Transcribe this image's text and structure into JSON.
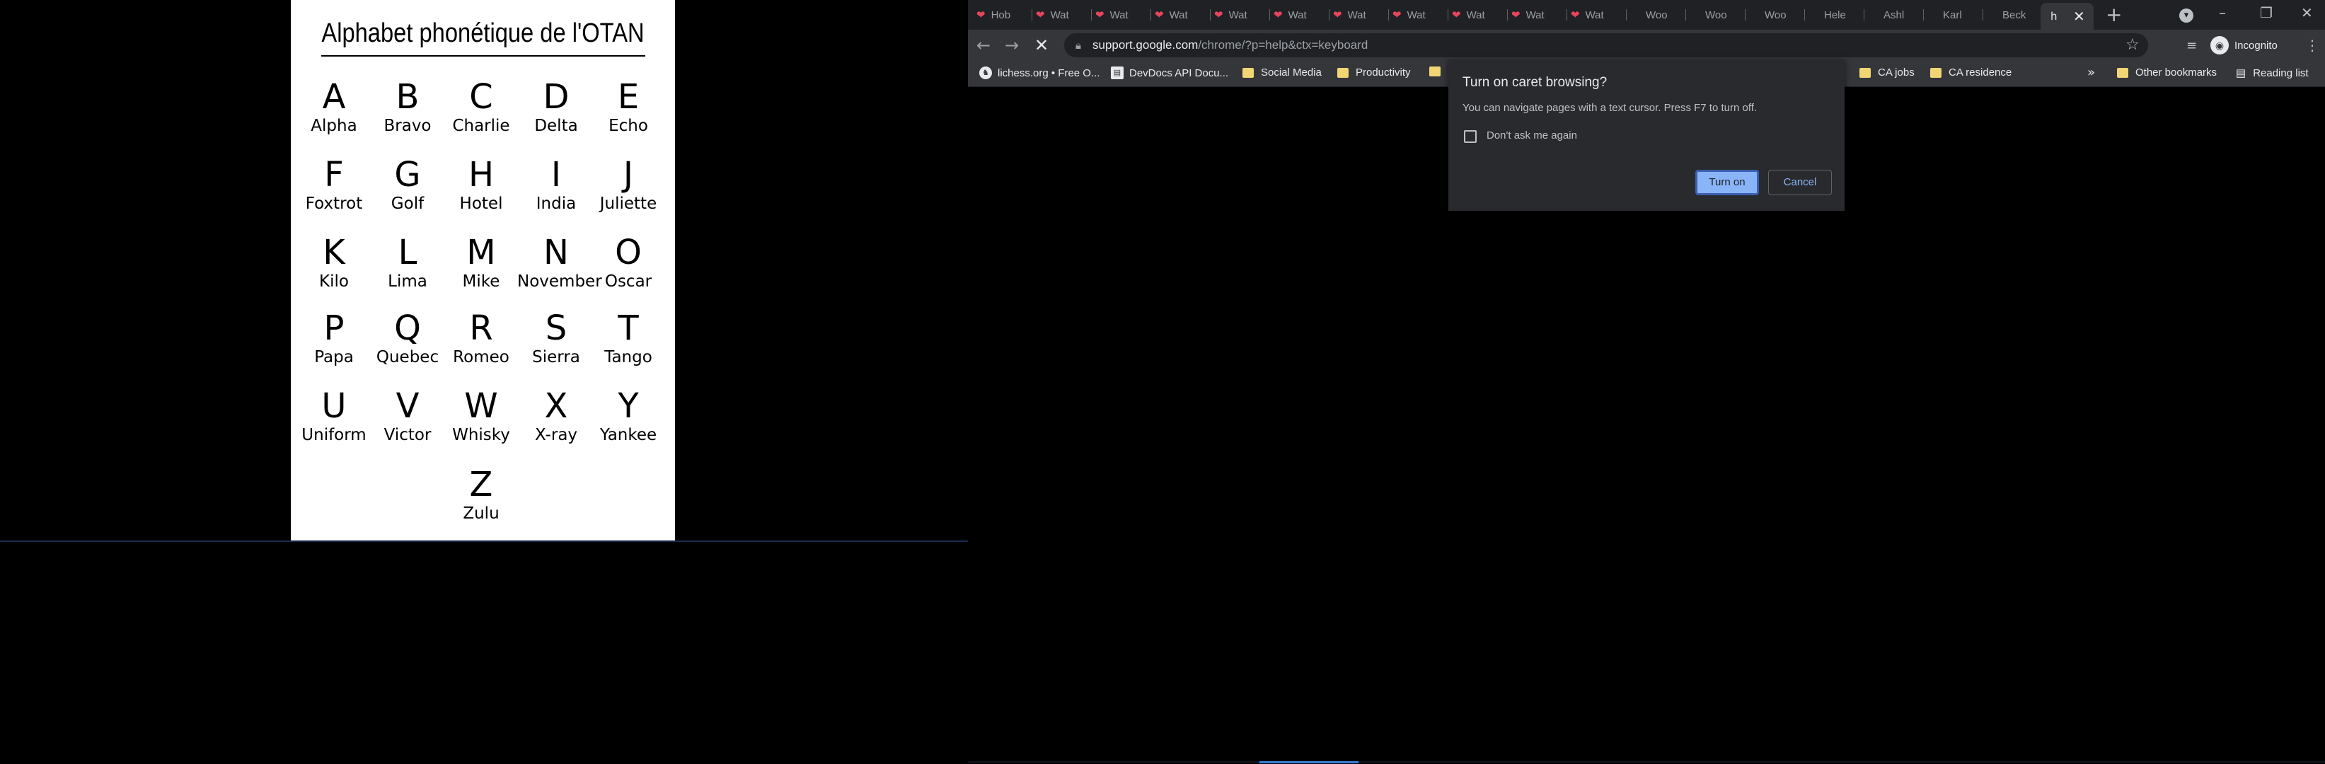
{
  "poster": {
    "title": "Alphabet phonétique de l'OTAN",
    "letters": [
      {
        "letter": "A",
        "word": "Alpha"
      },
      {
        "letter": "B",
        "word": "Bravo"
      },
      {
        "letter": "C",
        "word": "Charlie"
      },
      {
        "letter": "D",
        "word": "Delta"
      },
      {
        "letter": "E",
        "word": "Echo"
      },
      {
        "letter": "F",
        "word": "Foxtrot"
      },
      {
        "letter": "G",
        "word": "Golf"
      },
      {
        "letter": "H",
        "word": "Hotel"
      },
      {
        "letter": "I",
        "word": "India"
      },
      {
        "letter": "J",
        "word": "Juliette"
      },
      {
        "letter": "K",
        "word": "Kilo"
      },
      {
        "letter": "L",
        "word": "Lima"
      },
      {
        "letter": "M",
        "word": "Mike"
      },
      {
        "letter": "N",
        "word": "November"
      },
      {
        "letter": "O",
        "word": "Oscar"
      },
      {
        "letter": "P",
        "word": "Papa"
      },
      {
        "letter": "Q",
        "word": "Quebec"
      },
      {
        "letter": "R",
        "word": "Romeo"
      },
      {
        "letter": "S",
        "word": "Sierra"
      },
      {
        "letter": "T",
        "word": "Tango"
      },
      {
        "letter": "U",
        "word": "Uniform"
      },
      {
        "letter": "V",
        "word": "Victor"
      },
      {
        "letter": "W",
        "word": "Whisky"
      },
      {
        "letter": "X",
        "word": "X-ray"
      },
      {
        "letter": "Y",
        "word": "Yankee"
      },
      {
        "letter": "Z",
        "word": "Zulu"
      }
    ]
  },
  "browser": {
    "tabs": [
      {
        "label": "Hob",
        "icon": "heart-icon"
      },
      {
        "label": "Wat",
        "icon": "heart-icon"
      },
      {
        "label": "Wat",
        "icon": "heart-icon"
      },
      {
        "label": "Wat",
        "icon": "heart-icon"
      },
      {
        "label": "Wat",
        "icon": "heart-icon"
      },
      {
        "label": "Wat",
        "icon": "heart-icon"
      },
      {
        "label": "Wat",
        "icon": "heart-icon"
      },
      {
        "label": "Wat",
        "icon": "heart-icon"
      },
      {
        "label": "Wat",
        "icon": "heart-icon"
      },
      {
        "label": "Wat",
        "icon": "heart-icon"
      },
      {
        "label": "Wat",
        "icon": "heart-icon"
      },
      {
        "label": "Woo",
        "icon": ""
      },
      {
        "label": "Woo",
        "icon": ""
      },
      {
        "label": "Woo",
        "icon": ""
      },
      {
        "label": "Hele",
        "icon": ""
      },
      {
        "label": "Ashl",
        "icon": ""
      },
      {
        "label": "Karl",
        "icon": ""
      },
      {
        "label": "Beck",
        "icon": ""
      }
    ],
    "active_tab": {
      "label": "h",
      "close": "✕"
    },
    "new_tab": "+",
    "window_controls": {
      "minimize": "–",
      "restore": "❐",
      "close": "✕"
    },
    "url_host": "support.google.com",
    "url_path": "/chrome/?p=help&ctx=keyboard",
    "profile_label": "Incognito",
    "bookmarks": [
      {
        "label": "lichess.org • Free O...",
        "type": "site"
      },
      {
        "label": "DevDocs API Docu...",
        "type": "site"
      },
      {
        "label": "Social Media",
        "type": "folder"
      },
      {
        "label": "Productivity",
        "type": "folder"
      },
      {
        "label": "",
        "type": "folder"
      },
      {
        "label": "CA jobs",
        "type": "folder"
      },
      {
        "label": "CA residence",
        "type": "folder"
      }
    ],
    "bookmarks_overflow": "»",
    "other_bookmarks": "Other bookmarks",
    "reading_list": "Reading list",
    "dialog": {
      "title": "Turn on caret browsing?",
      "body": "You can navigate pages with a text cursor. Press F7 to turn off.",
      "checkbox_label": "Don't ask me again",
      "primary_button": "Turn on",
      "secondary_button": "Cancel"
    },
    "colors": {
      "accent": "#8ab4f8",
      "tab_heart": "#e8455d",
      "folder": "#f1d673"
    }
  }
}
